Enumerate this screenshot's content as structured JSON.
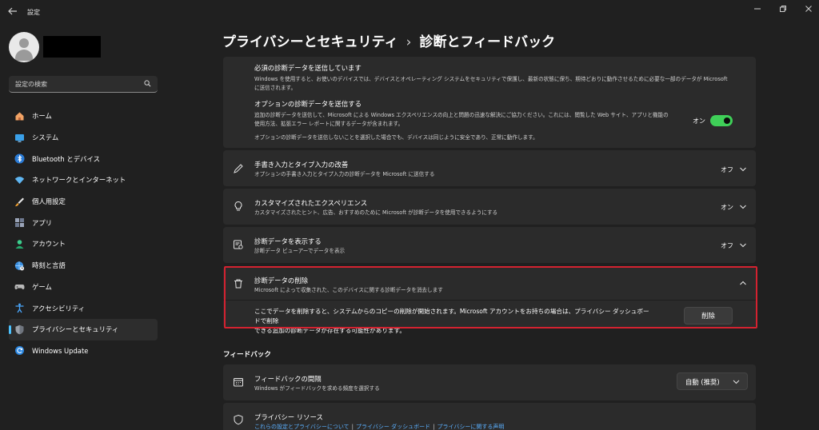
{
  "window": {
    "title": "設定"
  },
  "sidebar": {
    "search_placeholder": "設定の検索",
    "items": [
      {
        "label": "ホーム"
      },
      {
        "label": "システム"
      },
      {
        "label": "Bluetooth とデバイス"
      },
      {
        "label": "ネットワークとインターネット"
      },
      {
        "label": "個人用設定"
      },
      {
        "label": "アプリ"
      },
      {
        "label": "アカウント"
      },
      {
        "label": "時刻と言語"
      },
      {
        "label": "ゲーム"
      },
      {
        "label": "アクセシビリティ"
      },
      {
        "label": "プライバシーとセキュリティ",
        "selected": true
      },
      {
        "label": "Windows Update"
      }
    ]
  },
  "breadcrumb": {
    "parent": "プライバシーとセキュリティ",
    "separator": "›",
    "current": "診断とフィードバック"
  },
  "diagnostics": {
    "required": {
      "title": "必須の診断データを送信しています",
      "desc_1": "Windows を使用すると、お使いのデバイスでは、デバイスとオペレーティング システムをセキュリティで保護し、最新の状態に保ち、期待どおりに動作させるために必要な一部のデータが Microsoft",
      "desc_2": "に送信されます。"
    },
    "optional": {
      "title": "オプションの診断データを送信する",
      "desc_1": "追加の診断データを送信して、Microsoft による Windows エクスペリエンスの向上と問題の迅速な解決にご協力ください。これには、閲覧した Web サイト、アプリと機能の",
      "desc_2": "使用方法、拡張エラー レポートに関するデータが含まれます。",
      "note": "オプションの診断データを送信しないことを選択した場合でも、デバイスは同じように安全であり、正常に動作します。",
      "state": "オン",
      "toggle_on": true
    }
  },
  "handwriting": {
    "title": "手書き入力とタイプ入力の改善",
    "desc": "オプションの手書き入力とタイプ入力の診断データを Microsoft に送信する",
    "state": "オフ"
  },
  "tailored": {
    "title": "カスタマイズされたエクスペリエンス",
    "desc": "カスタマイズされたヒント、広告、おすすめのために Microsoft が診断データを使用できるようにする",
    "state": "オン"
  },
  "view_data": {
    "title": "診断データを表示する",
    "desc": "診断データ ビューアーでデータを表示",
    "state": "オフ"
  },
  "delete_data": {
    "title": "診断データの削除",
    "desc": "Microsoft によって収集された、このデバイスに関する診断データを消去します",
    "body_1": "ここでデータを削除すると、システムからのコピーの削除が開始されます。Microsoft アカウントをお持ちの場合は、プライバシー ダッシュボードで削除",
    "body_2": "できる追加の診断データが存在する可能性があります。",
    "button": "削除"
  },
  "feedback_section": {
    "heading": "フィードバック",
    "frequency": {
      "title": "フィードバックの間隔",
      "desc": "Windows がフィードバックを求める頻度を選択する",
      "value": "自動 (推奨)"
    },
    "privacy_resources": {
      "title": "プライバシー リソース",
      "links": [
        "これらの設定とプライバシーについて",
        "プライバシー ダッシュボード",
        "プライバシーに関する声明"
      ]
    }
  },
  "colors": {
    "accent": "#4cc2ff",
    "toggle_on": "#3fcf58",
    "highlight_frame": "#d42230",
    "link": "#5bb0ff"
  }
}
